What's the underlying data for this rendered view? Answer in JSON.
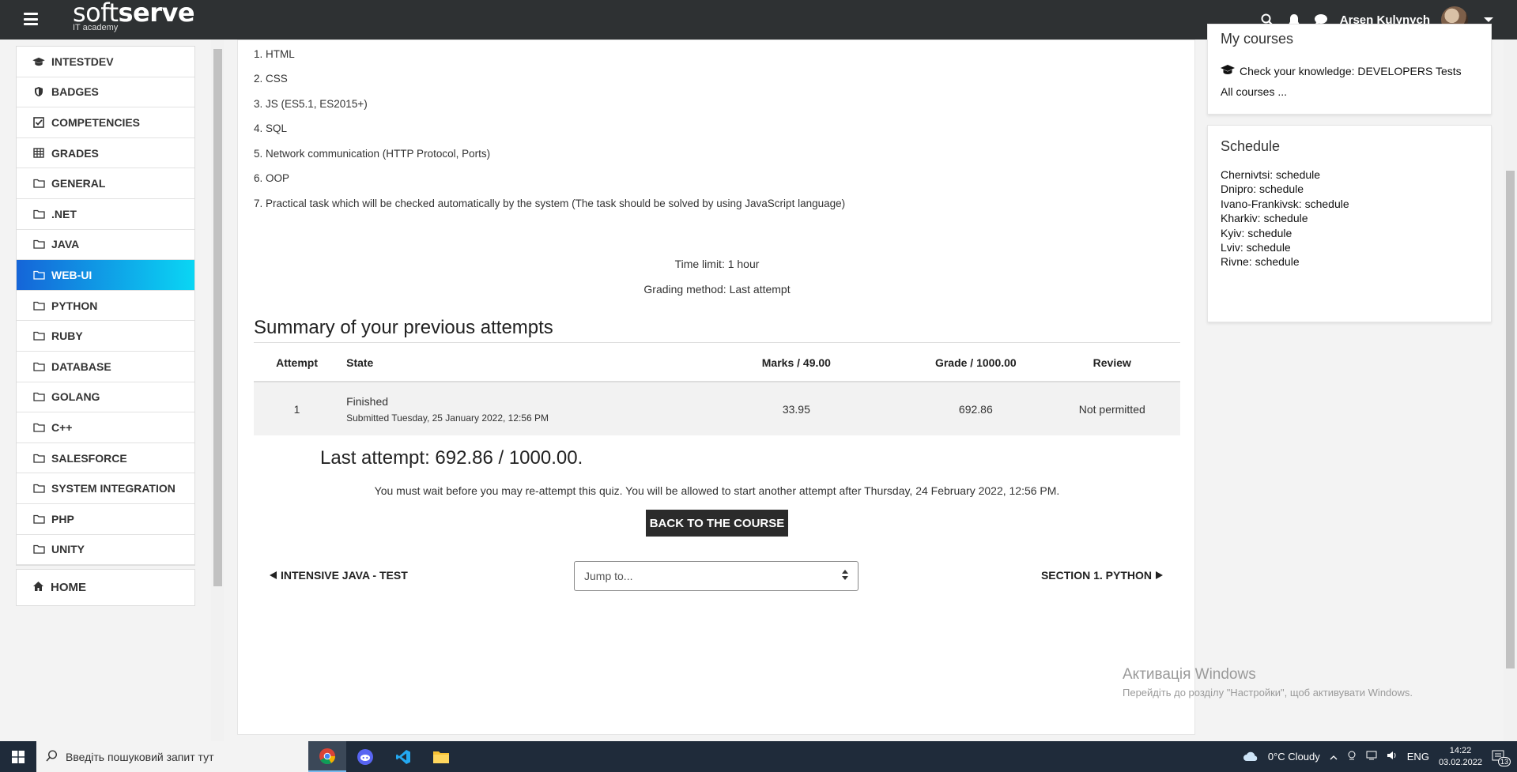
{
  "navbar": {
    "logo_main_light": "soft",
    "logo_main_bold": "serve",
    "logo_sub": "IT academy",
    "user_name": "Arsen Kulynych"
  },
  "drawer": {
    "items": [
      {
        "label": "INTESTDEV",
        "icon": "graduation-cap-icon"
      },
      {
        "label": "BADGES",
        "icon": "shield-icon"
      },
      {
        "label": "COMPETENCIES",
        "icon": "check-square-icon"
      },
      {
        "label": "GRADES",
        "icon": "table-icon"
      },
      {
        "label": "GENERAL",
        "icon": "folder-icon"
      },
      {
        "label": ".NET",
        "icon": "folder-icon"
      },
      {
        "label": "JAVA",
        "icon": "folder-icon"
      },
      {
        "label": "WEB-UI",
        "icon": "folder-icon",
        "active": true
      },
      {
        "label": "PYTHON",
        "icon": "folder-icon"
      },
      {
        "label": "RUBY",
        "icon": "folder-icon"
      },
      {
        "label": "DATABASE",
        "icon": "folder-icon"
      },
      {
        "label": "GOLANG",
        "icon": "folder-icon"
      },
      {
        "label": "C++",
        "icon": "folder-icon"
      },
      {
        "label": "SALESFORCE",
        "icon": "folder-icon"
      },
      {
        "label": "SYSTEM INTEGRATION",
        "icon": "folder-icon"
      },
      {
        "label": "PHP",
        "icon": "folder-icon"
      },
      {
        "label": "UNITY",
        "icon": "folder-icon"
      }
    ],
    "home_label": "HOME"
  },
  "main": {
    "topics": [
      "1. HTML",
      "2. CSS",
      "3. JS (ES5.1, ES2015+)",
      "4. SQL",
      "5. Network communication (HTTP Protocol, Ports)",
      "6. OOP",
      "7. Practical task which will be checked automatically by the system (The task should be solved by using JavaScript language)"
    ],
    "time_limit": "Time limit: 1 hour",
    "grading_method": "Grading method: Last attempt",
    "summary_title": "Summary of your previous attempts",
    "table": {
      "headers": [
        "Attempt",
        "State",
        "Marks / 49.00",
        "Grade / 1000.00",
        "Review"
      ],
      "rows": [
        {
          "attempt": "1",
          "state": "Finished",
          "submitted": "Submitted Tuesday, 25 January 2022, 12:56 PM",
          "marks": "33.95",
          "grade": "692.86",
          "review": "Not permitted"
        }
      ]
    },
    "last_attempt": "Last attempt: 692.86 / 1000.00.",
    "wait_message": "You must wait before you may re-attempt this quiz. You will be allowed to start another attempt after Thursday, 24 February 2022, 12:56 PM.",
    "back_button": "BACK TO THE COURSE",
    "prev_link": "INTENSIVE JAVA - TEST",
    "jump_placeholder": "Jump to...",
    "next_link": "SECTION 1. PYTHON"
  },
  "my_courses": {
    "title": "My courses",
    "course": "Check your knowledge: DEVELOPERS Tests",
    "all_courses": "All courses ..."
  },
  "schedule": {
    "title": "Schedule",
    "items": [
      "Chernivtsi: schedule",
      "Dnipro: schedule",
      "Ivano-Frankivsk: schedule",
      "Kharkiv: schedule",
      "Kyiv: schedule",
      "Lviv: schedule",
      "Rivne: schedule"
    ]
  },
  "watermark": {
    "title": "Активація Windows",
    "subtitle": "Перейдіть до розділу \"Настройки\", щоб активувати Windows."
  },
  "taskbar": {
    "search_placeholder": "Введіть пошуковий запит тут",
    "weather": "0°C  Cloudy",
    "language": "ENG",
    "time": "14:22",
    "date": "03.02.2022",
    "notifications": "13"
  },
  "colors": {
    "navbar": "#2e3133",
    "active_start": "#1565d8",
    "active_end": "#0ad6f4",
    "taskbar": "#1f2b3a"
  }
}
